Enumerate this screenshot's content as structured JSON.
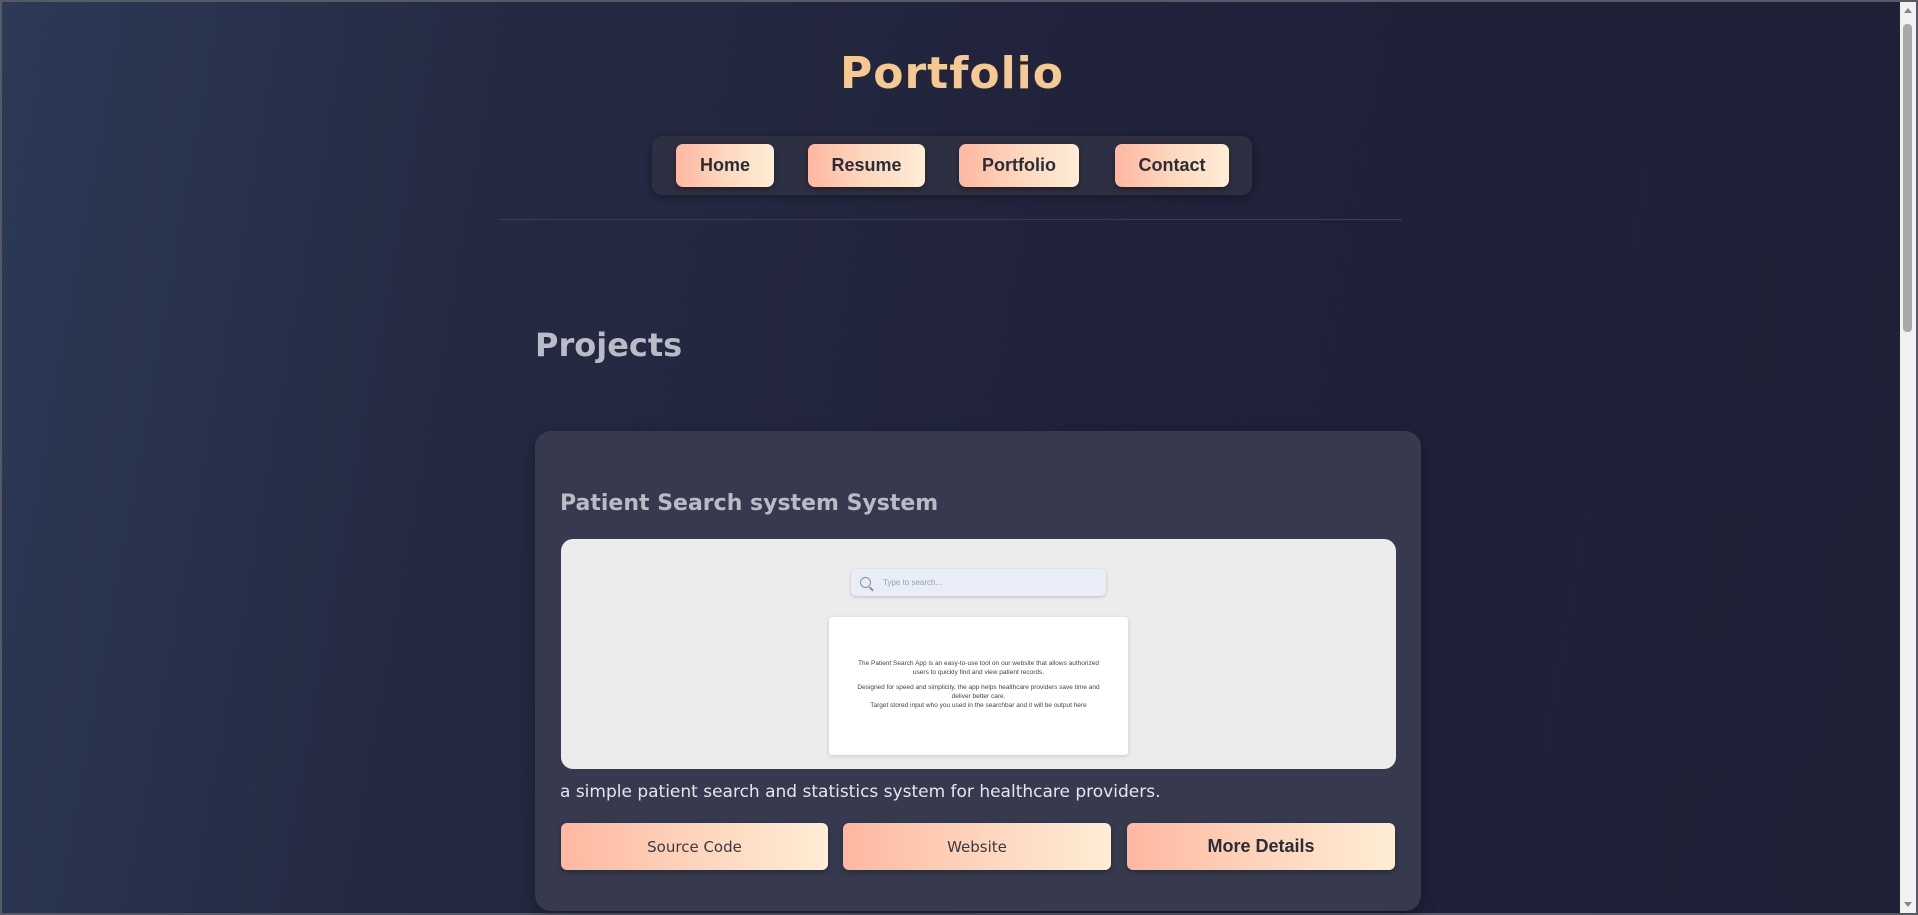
{
  "header": {
    "title": "Portfolio"
  },
  "nav": {
    "items": [
      {
        "label": "Home"
      },
      {
        "label": "Resume"
      },
      {
        "label": "Portfolio"
      },
      {
        "label": "Contact"
      }
    ]
  },
  "projects": {
    "section_title": "Projects",
    "items": [
      {
        "title": "Patient Search system System",
        "preview": {
          "search_placeholder": "Type to search...",
          "paragraph_1": "The Patient Search App is an easy-to-use tool on our website that allows authorized users to quickly find and view patient records.",
          "paragraph_2": "Designed for speed and simplicity, the app helps healthcare providers save time and deliver better care.",
          "paragraph_3": "Target stored input who you used in the searchbar and it will be output here"
        },
        "description": "a simple patient search and statistics system for healthcare providers.",
        "buttons": {
          "source_code": "Source Code",
          "website": "Website",
          "more_details": "More Details"
        }
      }
    ]
  },
  "colors": {
    "accent_title": "#f5c98f",
    "button_gradient_start": "#ffb7a1",
    "button_gradient_end": "#ffedd5",
    "card_background": "#373a4e"
  }
}
